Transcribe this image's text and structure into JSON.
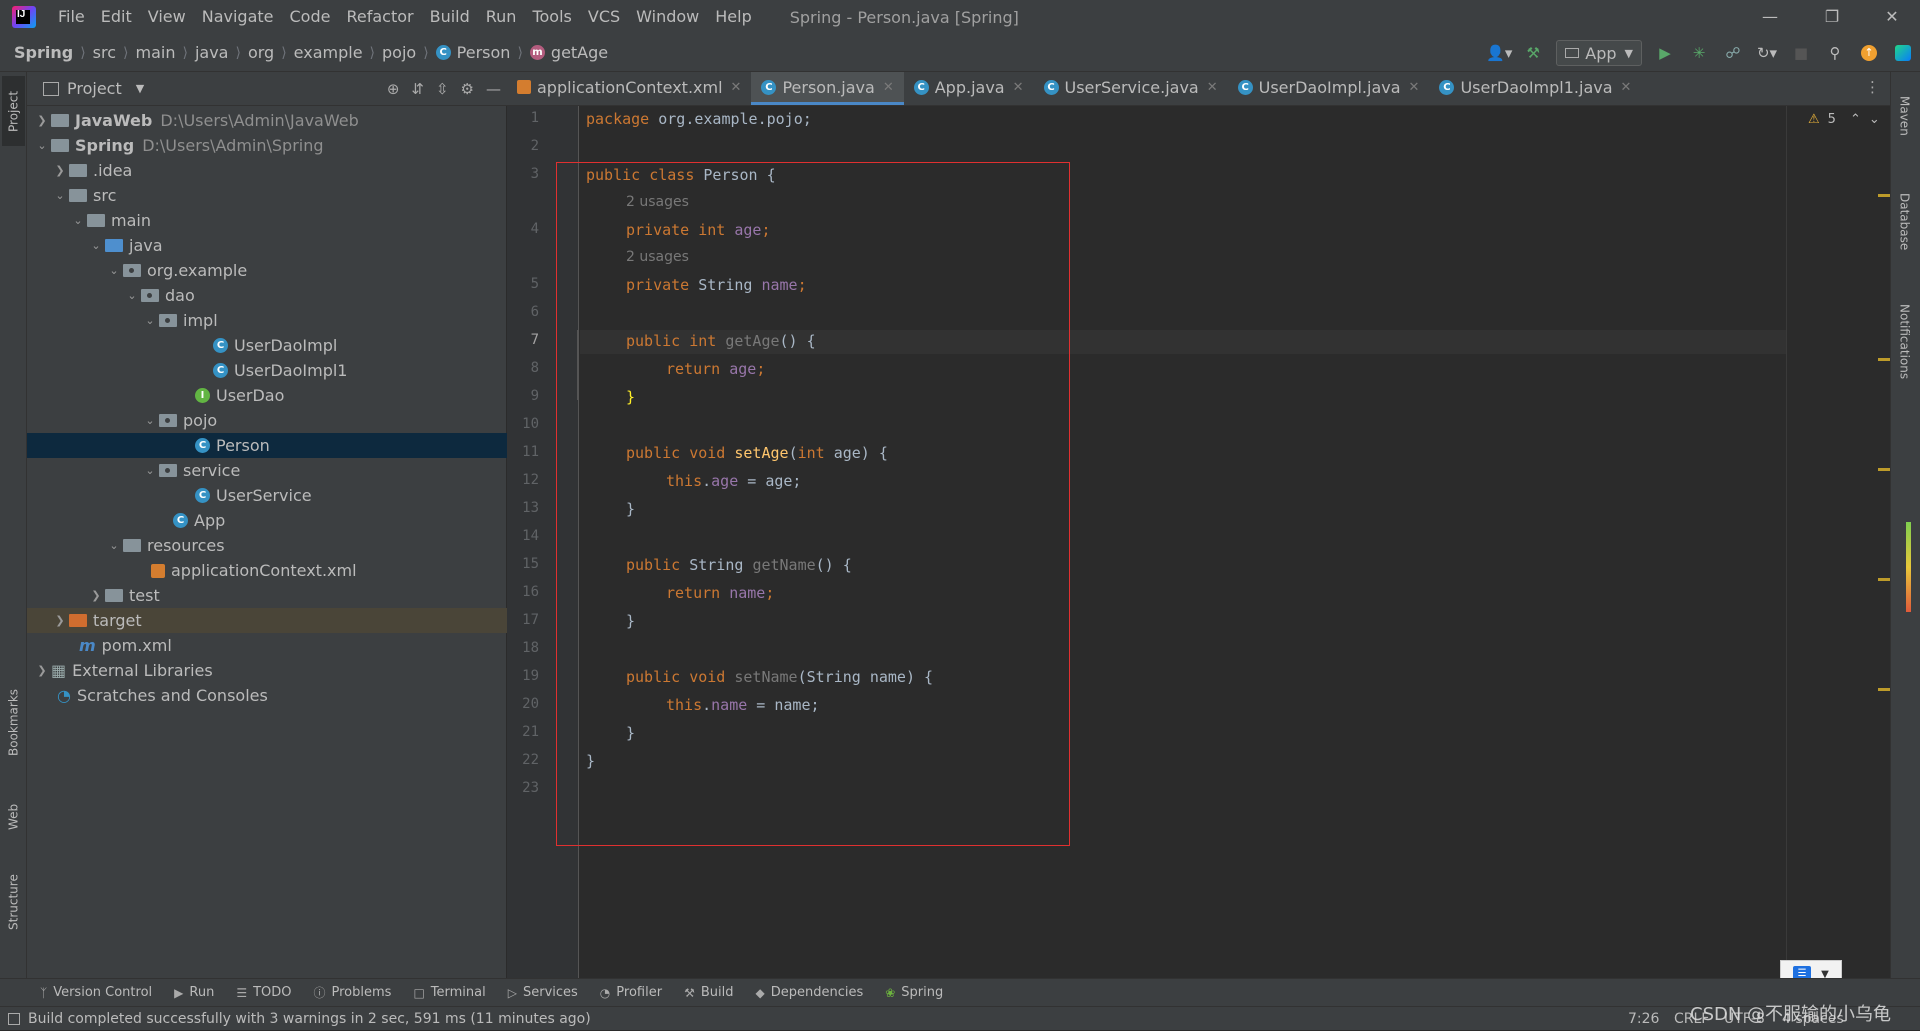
{
  "window": {
    "title": "Spring - Person.java [Spring]",
    "menu": [
      "File",
      "Edit",
      "View",
      "Navigate",
      "Code",
      "Refactor",
      "Build",
      "Run",
      "Tools",
      "VCS",
      "Window",
      "Help"
    ]
  },
  "breadcrumb": {
    "items": [
      "Spring",
      "src",
      "main",
      "java",
      "org",
      "example",
      "pojo",
      "Person",
      "getAge"
    ]
  },
  "toolbar": {
    "run_config": "App"
  },
  "project_panel": {
    "title": "Project",
    "tree": [
      {
        "label": "JavaWeb",
        "path": "D:\\Users\\Admin\\JavaWeb",
        "bold": true
      },
      {
        "label": "Spring",
        "path": "D:\\Users\\Admin\\Spring",
        "bold": true
      },
      {
        "label": ".idea"
      },
      {
        "label": "src"
      },
      {
        "label": "main"
      },
      {
        "label": "java"
      },
      {
        "label": "org.example"
      },
      {
        "label": "dao"
      },
      {
        "label": "impl"
      },
      {
        "label": "UserDaoImpl"
      },
      {
        "label": "UserDaoImpl1"
      },
      {
        "label": "UserDao"
      },
      {
        "label": "pojo"
      },
      {
        "label": "Person"
      },
      {
        "label": "service"
      },
      {
        "label": "UserService"
      },
      {
        "label": "App"
      },
      {
        "label": "resources"
      },
      {
        "label": "applicationContext.xml"
      },
      {
        "label": "test"
      },
      {
        "label": "target"
      },
      {
        "label": "pom.xml"
      },
      {
        "label": "External Libraries"
      },
      {
        "label": "Scratches and Consoles"
      }
    ]
  },
  "editor_tabs": [
    "applicationContext.xml",
    "Person.java",
    "App.java",
    "UserService.java",
    "UserDaoImpl.java",
    "UserDaoImpl1.java"
  ],
  "editor": {
    "warnings": "5",
    "line_numbers": [
      "1",
      "2",
      "3",
      "4",
      "5",
      "6",
      "7",
      "8",
      "9",
      "10",
      "11",
      "12",
      "13",
      "14",
      "15",
      "16",
      "17",
      "18",
      "19",
      "20",
      "21",
      "22",
      "23"
    ],
    "code": {
      "l1_kw": "package",
      "l1_rest": " org.example.pojo;",
      "l3_kw": "public class",
      "l3_rest": " Person {",
      "hint1": "2 usages",
      "l4_kw": "private int",
      "l4_fld": "age",
      "hint2": "2 usages",
      "l5_kw": "private",
      "l5_type": " String ",
      "l5_fld": "name",
      "l7_kw": "public int",
      "l7_fn": "getAge",
      "l7_rest": "() {",
      "l8_kw": "return",
      "l8_fld": "age",
      "l9": "}",
      "l11_kw": "public void",
      "l11_fn": "setAge",
      "l11_kw2": "int",
      "l11_rest": " age) {",
      "l12_kw": "this",
      "l12_fld": "age",
      "l12_rest": " = age;",
      "l13": "}",
      "l15_kw": "public",
      "l15_type": " String ",
      "l15_fn": "getName",
      "l15_rest": "() {",
      "l16_kw": "return",
      "l16_fld": "name",
      "l17": "}",
      "l19_kw": "public void",
      "l19_fn": "setName",
      "l19_rest": "(String name) {",
      "l20_kw": "this",
      "l20_fld": "name",
      "l20_rest": " = name;",
      "l21": "}",
      "l22": "}"
    }
  },
  "side_tabs": {
    "left": [
      "Project",
      "Bookmarks",
      "Web",
      "Structure"
    ],
    "right": [
      "Maven",
      "Database",
      "Notifications"
    ]
  },
  "bottom_tabs": [
    "Version Control",
    "Run",
    "TODO",
    "Problems",
    "Terminal",
    "Services",
    "Profiler",
    "Build",
    "Dependencies",
    "Spring"
  ],
  "status": {
    "message": "Build completed successfully with 3 warnings in 2 sec, 591 ms (11 minutes ago)",
    "position": "7:26",
    "line_sep": "CRLF",
    "encoding": "UTF-8",
    "indent": "4 spaces"
  },
  "watermark": "CSDN @不服输的小乌龟"
}
